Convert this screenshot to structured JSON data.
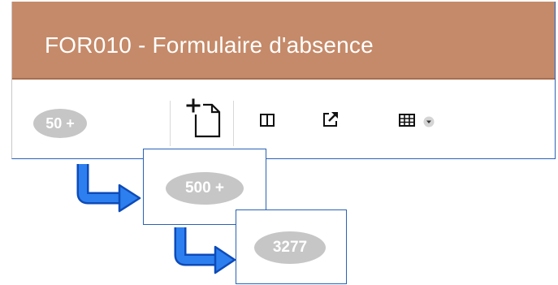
{
  "header": {
    "title": "FOR010 - Formulaire d'absence",
    "color": "#c58a69"
  },
  "toolbar": {
    "badge_count": "50 +",
    "icons": [
      "add-document-icon",
      "split-view-icon",
      "external-link-icon",
      "table-icon",
      "chevron-down-icon"
    ]
  },
  "callouts": [
    {
      "badge": "500 +"
    },
    {
      "badge": "3277"
    }
  ],
  "colors": {
    "badge_bg": "#c6c6c6",
    "badge_text": "#ffffff",
    "accent_border": "#2a62b6",
    "arrow": "#1f6fe0"
  }
}
